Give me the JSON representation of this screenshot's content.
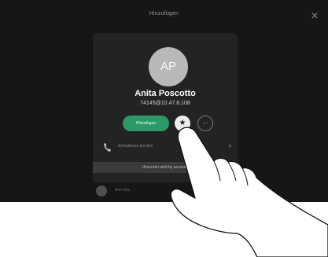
{
  "header": {
    "title": "Hinzufügen",
    "close_glyph": "×"
  },
  "contact": {
    "initials": "AP",
    "name": "Anita Poscotto",
    "number": "74145@10.47.8.108"
  },
  "actions": {
    "add_label": "Hinzufügen",
    "favorite_glyph": "★",
    "more_glyph": "···",
    "row_label": "Einhaltenes anrufen",
    "row_chevron": "›"
  },
  "banner": {
    "text": "Unscreen wird by accused"
  },
  "bottom_item": {
    "label": "Anh Uno"
  },
  "icons": {
    "phone": "phone-icon",
    "close": "close-icon",
    "star": "star-icon",
    "more": "more-icon",
    "chevron": "chevron-right-icon"
  },
  "colors": {
    "screen_bg": "#161616",
    "card_bg": "#232323",
    "accent_green": "#2b9a66",
    "avatar_gray": "#b9b9b9"
  }
}
